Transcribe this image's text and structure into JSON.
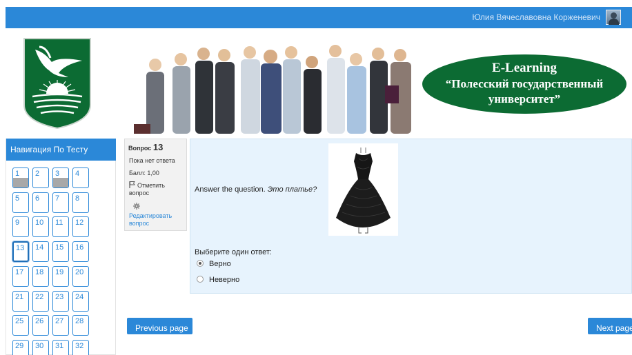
{
  "header": {
    "user_name": "Юлия Вячеславовна Корженевич"
  },
  "banner": {
    "line1": "E-Learning",
    "line2": "“Полесский государственный",
    "line3": "университет”"
  },
  "colors": {
    "primary": "#2b88d8",
    "brand_green": "#0c6b33",
    "content_bg": "#e7f3fd"
  },
  "quiz_nav": {
    "title": "Навигация По Тесту",
    "questions": [
      {
        "label": "1",
        "state": "answered"
      },
      {
        "label": "2",
        "state": "notanswered"
      },
      {
        "label": "3",
        "state": "answered"
      },
      {
        "label": "4",
        "state": "notanswered"
      },
      {
        "label": "5",
        "state": "notanswered"
      },
      {
        "label": "6",
        "state": "notanswered"
      },
      {
        "label": "7",
        "state": "notanswered"
      },
      {
        "label": "8",
        "state": "notanswered"
      },
      {
        "label": "9",
        "state": "notanswered"
      },
      {
        "label": "10",
        "state": "notanswered"
      },
      {
        "label": "11",
        "state": "notanswered"
      },
      {
        "label": "12",
        "state": "notanswered"
      },
      {
        "label": "13",
        "state": "current"
      },
      {
        "label": "14",
        "state": "notanswered"
      },
      {
        "label": "15",
        "state": "notanswered"
      },
      {
        "label": "16",
        "state": "notanswered"
      },
      {
        "label": "17",
        "state": "notanswered"
      },
      {
        "label": "18",
        "state": "notanswered"
      },
      {
        "label": "19",
        "state": "notanswered"
      },
      {
        "label": "20",
        "state": "notanswered"
      },
      {
        "label": "21",
        "state": "notanswered"
      },
      {
        "label": "22",
        "state": "notanswered"
      },
      {
        "label": "23",
        "state": "notanswered"
      },
      {
        "label": "24",
        "state": "notanswered"
      },
      {
        "label": "25",
        "state": "notanswered"
      },
      {
        "label": "26",
        "state": "notanswered"
      },
      {
        "label": "27",
        "state": "notanswered"
      },
      {
        "label": "28",
        "state": "notanswered"
      },
      {
        "label": "29",
        "state": "notanswered"
      },
      {
        "label": "30",
        "state": "notanswered"
      },
      {
        "label": "31",
        "state": "notanswered"
      },
      {
        "label": "32",
        "state": "notanswered"
      }
    ]
  },
  "question_info": {
    "label": "Вопрос",
    "number": "13",
    "state": "Пока нет ответа",
    "grade": "Балл: 1,00",
    "flag": "Отметить вопрос",
    "edit": "Редактировать вопрос"
  },
  "question": {
    "text": "Answer the question.",
    "text_italic": "Это платье?",
    "image_icon": "black-dress-image",
    "prompt": "Выберите один ответ:",
    "options": [
      {
        "label": "Верно",
        "checked": true
      },
      {
        "label": "Неверно",
        "checked": false
      }
    ]
  },
  "buttons": {
    "previous": "Previous page",
    "next": "Next page"
  }
}
